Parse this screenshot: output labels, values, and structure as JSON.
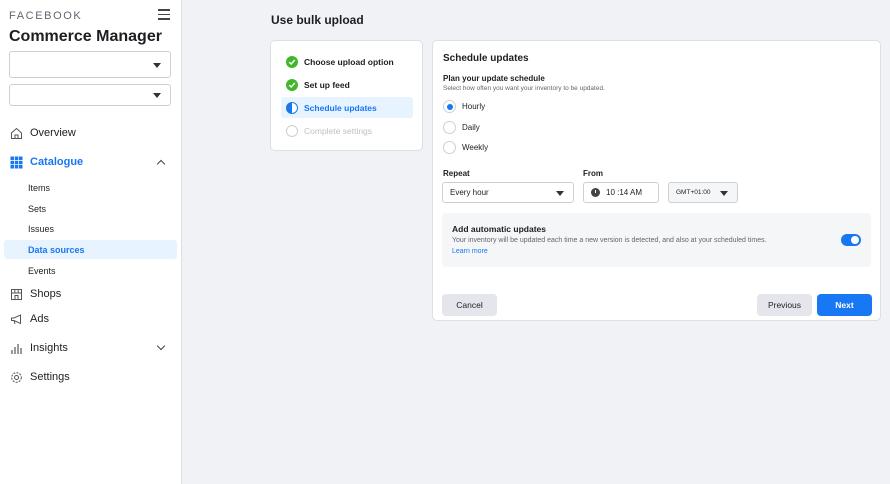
{
  "sidebar": {
    "brand": "FACEBOOK",
    "app_title": "Commerce Manager",
    "select_1_value": "",
    "select_2_value": "",
    "nav": [
      {
        "label": "Overview",
        "icon": "house-icon"
      },
      {
        "label": "Catalogue",
        "icon": "grid-icon",
        "expanded": true
      },
      {
        "label": "Shops",
        "icon": "store-icon"
      },
      {
        "label": "Ads",
        "icon": "megaphone-icon"
      },
      {
        "label": "Insights",
        "icon": "bar-chart-icon",
        "expanded": false
      },
      {
        "label": "Settings",
        "icon": "gear-icon"
      }
    ],
    "catalogue_items": [
      "Items",
      "Sets",
      "Issues",
      "Data sources",
      "Events"
    ],
    "selected_sub_item": "Data sources"
  },
  "main": {
    "title": "Use bulk upload",
    "steps": [
      {
        "label": "Choose upload option",
        "state": "done"
      },
      {
        "label": "Set up feed",
        "state": "done"
      },
      {
        "label": "Schedule updates",
        "state": "current"
      },
      {
        "label": "Complete settings",
        "state": "pending"
      }
    ],
    "card": {
      "title": "Schedule updates",
      "plan_label": "Plan your update schedule",
      "plan_desc": "Select how often you want your inventory to be updated.",
      "frequency_options": [
        "Hourly",
        "Daily",
        "Weekly"
      ],
      "selected_frequency": "Hourly",
      "repeat_label": "Repeat",
      "repeat_value": "Every hour",
      "from_label": "From",
      "time_value": "10 :14 AM",
      "timezone_value": "GMT+01:00",
      "auto_title": "Add automatic updates",
      "auto_desc": "Your inventory will be updated each time a new version is detected, and also at your scheduled times.",
      "auto_link": "Learn more",
      "auto_enabled": true,
      "cancel_label": "Cancel",
      "previous_label": "Previous",
      "next_label": "Next"
    }
  },
  "colors": {
    "accent": "#1877f2",
    "success": "#42b72a",
    "sidebar_selected_bg": "#e7f3ff",
    "page_bg": "#f0f2f5"
  }
}
